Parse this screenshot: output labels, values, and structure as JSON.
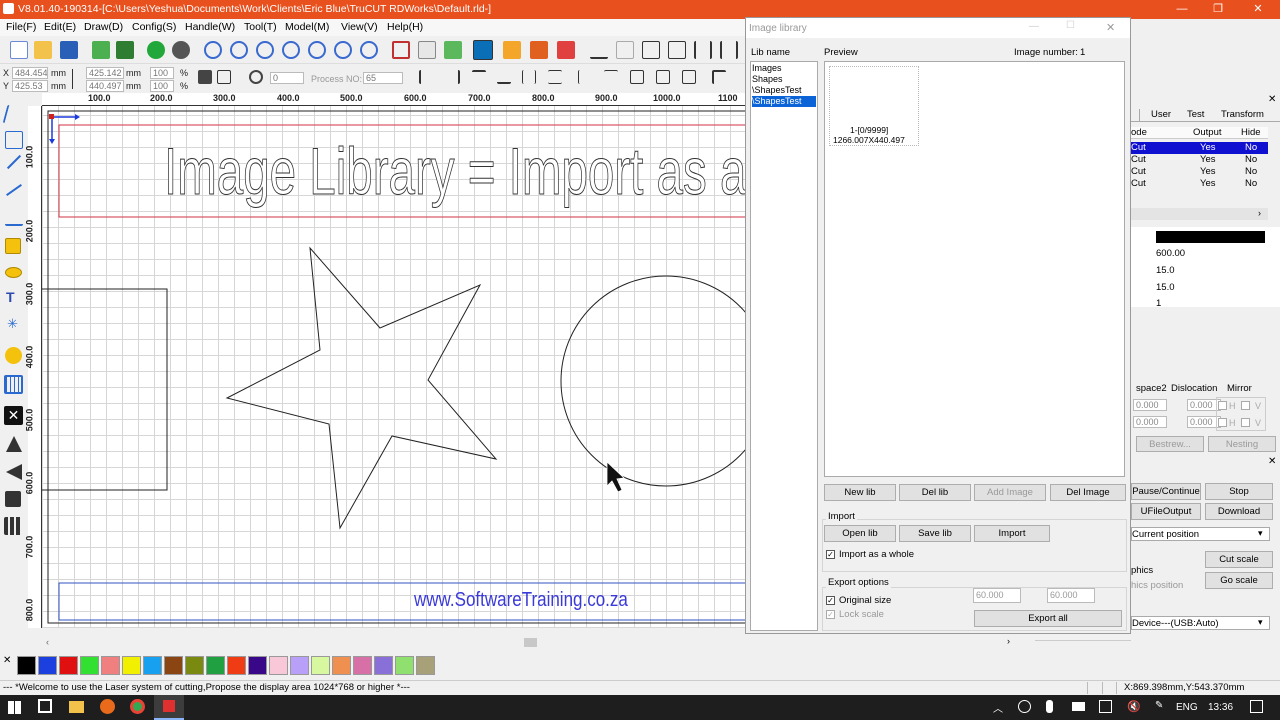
{
  "window": {
    "title": "V8.01.40-190314-[C:\\Users\\Yeshua\\Documents\\Work\\Clients\\Eric Blue\\TruCUT RDWorks\\Default.rld-]"
  },
  "menu": [
    "File(F)",
    "Edit(E)",
    "Draw(D)",
    "Config(S)",
    "Handle(W)",
    "Tool(T)",
    "Model(M)",
    "View(V)",
    "Help(H)"
  ],
  "coords": {
    "x_label": "X",
    "x_value": "484.454",
    "y_label": "Y",
    "y_value": "425.53",
    "unit": "mm",
    "w_value": "425.142",
    "h_value": "440.497",
    "scale_w": "100",
    "scale_h": "100",
    "pct": "%",
    "rotation": "0",
    "process_label": "Process NO:",
    "process_value": "65"
  },
  "ruler": {
    "h_ticks": [
      "100.0",
      "200.0",
      "300.0",
      "400.0",
      "500.0",
      "600.0",
      "700.0",
      "800.0",
      "900.0",
      "1000.0",
      "1100"
    ],
    "v_ticks": [
      "100.0",
      "200.0",
      "300.0",
      "400.0",
      "500.0",
      "600.0",
      "700.0",
      "800.0"
    ]
  },
  "canvas": {
    "banner_text": "Image Library = Import as a",
    "footer_text": "www.SoftwareTraining.co.za"
  },
  "image_library": {
    "title": "Image library",
    "lib_name_label": "Lib name",
    "preview_label": "Preview",
    "image_number_label": "Image number:",
    "image_number_value": "1",
    "lib_items": [
      "Images",
      "Shapes",
      "\\ShapesTest",
      "\\ShapesTest"
    ],
    "selected_index": 3,
    "preview_line1": "1-[0/9999]",
    "preview_line2": "1266.007X440.497",
    "buttons": {
      "new_lib": "New lib",
      "del_lib": "Del lib",
      "add_image": "Add Image",
      "del_image": "Del Image"
    },
    "import_group": {
      "label": "Import",
      "open_lib": "Open lib",
      "save_lib": "Save lib",
      "import": "Import",
      "import_whole": "Import as a whole",
      "import_whole_checked": true
    },
    "export_group": {
      "label": "Export options",
      "original_size": "Original size",
      "original_size_checked": true,
      "lock_scale": "Lock scale",
      "width": "60.000",
      "height": "60.000",
      "export_all": "Export all"
    }
  },
  "right_panel": {
    "tabs": [
      "User",
      "Test",
      "Transform"
    ],
    "layer_headers": [
      "ode",
      "Output",
      "Hide"
    ],
    "layers": [
      {
        "mode": "Cut",
        "output": "Yes",
        "hide": "No",
        "selected": true
      },
      {
        "mode": "Cut",
        "output": "Yes",
        "hide": "No",
        "selected": false
      },
      {
        "mode": "Cut",
        "output": "Yes",
        "hide": "No",
        "selected": false
      },
      {
        "mode": "Cut",
        "output": "Yes",
        "hide": "No",
        "selected": false
      }
    ],
    "properties": [
      "600.00",
      "15.0",
      "15.0",
      "1"
    ],
    "array_headers": [
      "space2",
      "Dislocation",
      "Mirror"
    ],
    "array_values": [
      "0.000",
      "0.000",
      "0.000",
      "0.000"
    ],
    "mirror_h": "H",
    "mirror_v": "V",
    "bestrew": "Bestrew...",
    "nesting": "Nesting",
    "controls": {
      "pause": "Pause/Continue",
      "stop": "Stop",
      "ufile": "UFileOutput",
      "download": "Download",
      "position": "Current position",
      "graphics": "phics",
      "graphics_pos": "hics position",
      "cut_scale": "Cut scale",
      "go_scale": "Go scale",
      "device": "Device---(USB:Auto)"
    }
  },
  "status": {
    "message": "--- *Welcome to use the Laser system of cutting,Propose the display area 1024*768 or higher *---",
    "coords": "X:869.398mm,Y:543.370mm"
  },
  "taskbar": {
    "lang": "ENG",
    "time": "13:36"
  },
  "palette": [
    "#000000",
    "#1c3fe0",
    "#e01010",
    "#32e032",
    "#f08080",
    "#f0f000",
    "#18a0f0",
    "#8b4513",
    "#7a8a10",
    "#20a040",
    "#f03c14",
    "#380888",
    "#f8c8d8",
    "#b8a0f8",
    "#d8f8a0",
    "#f09050",
    "#d870a8",
    "#8870d8",
    "#90e070",
    "#a8a078"
  ]
}
